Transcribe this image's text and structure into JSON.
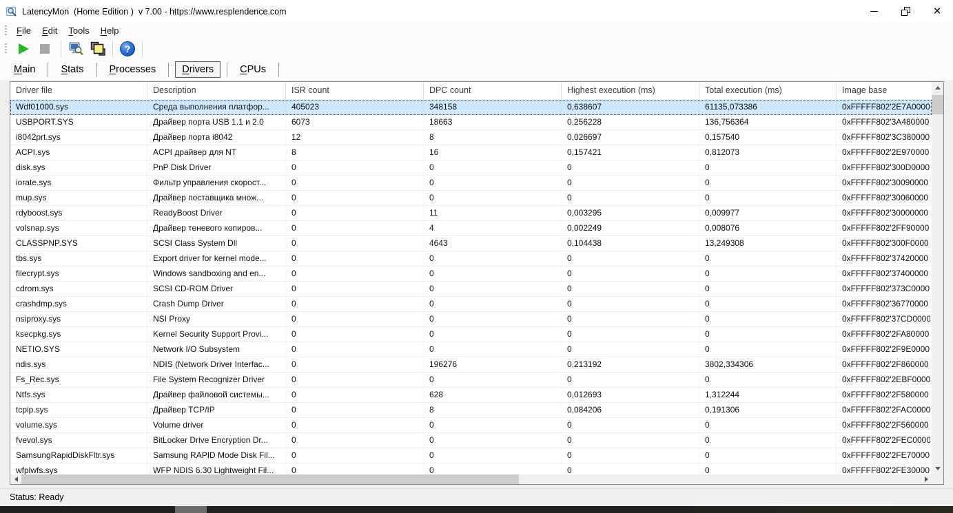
{
  "titlebar": {
    "title": "LatencyMon  (Home Edition )  v 7.00 - https://www.resplendence.com"
  },
  "menu": {
    "items": [
      {
        "label": "File"
      },
      {
        "label": "Edit"
      },
      {
        "label": "Tools"
      },
      {
        "label": "Help"
      }
    ]
  },
  "toolbar": {
    "icons": [
      "play-icon",
      "stop-icon",
      "monitor-analyze-icon",
      "report-windows-icon",
      "help-icon"
    ]
  },
  "tabs": {
    "items": [
      {
        "label": "Main",
        "selected": false
      },
      {
        "label": "Stats",
        "selected": false
      },
      {
        "label": "Processes",
        "selected": false
      },
      {
        "label": "Drivers",
        "selected": true
      },
      {
        "label": "CPUs",
        "selected": false
      }
    ]
  },
  "table": {
    "columns": [
      {
        "key": "driver-file",
        "label": "Driver file"
      },
      {
        "key": "description",
        "label": "Description"
      },
      {
        "key": "isr-count",
        "label": "ISR count"
      },
      {
        "key": "dpc-count",
        "label": "DPC count"
      },
      {
        "key": "highest-execution",
        "label": "Highest execution (ms)"
      },
      {
        "key": "total-execution",
        "label": "Total execution (ms)"
      },
      {
        "key": "image-base",
        "label": "Image base"
      }
    ],
    "rows": [
      {
        "selected": true,
        "cells": [
          "Wdf01000.sys",
          "Среда выполнения платфор...",
          "405023",
          "348158",
          "0,638607",
          "61135,073386",
          "0xFFFFF802'2E7A0000"
        ]
      },
      {
        "selected": false,
        "cells": [
          "USBPORT.SYS",
          "Драйвер порта USB 1.1 и 2.0",
          "6073",
          "18663",
          "0,256228",
          "136,756364",
          "0xFFFFF802'3A480000"
        ]
      },
      {
        "selected": false,
        "cells": [
          "i8042prt.sys",
          "Драйвер порта i8042",
          "12",
          "8",
          "0,026697",
          "0,157540",
          "0xFFFFF802'3C380000"
        ]
      },
      {
        "selected": false,
        "cells": [
          "ACPI.sys",
          "ACPI драйвер для NT",
          "8",
          "16",
          "0,157421",
          "0,812073",
          "0xFFFFF802'2E970000"
        ]
      },
      {
        "selected": false,
        "cells": [
          "disk.sys",
          "PnP Disk Driver",
          "0",
          "0",
          "0",
          "0",
          "0xFFFFF802'300D0000"
        ]
      },
      {
        "selected": false,
        "cells": [
          "iorate.sys",
          "Фильтр управления скорост...",
          "0",
          "0",
          "0",
          "0",
          "0xFFFFF802'30090000"
        ]
      },
      {
        "selected": false,
        "cells": [
          "mup.sys",
          "Драйвер поставщика множ...",
          "0",
          "0",
          "0",
          "0",
          "0xFFFFF802'30060000"
        ]
      },
      {
        "selected": false,
        "cells": [
          "rdyboost.sys",
          "ReadyBoost Driver",
          "0",
          "11",
          "0,003295",
          "0,009977",
          "0xFFFFF802'30000000"
        ]
      },
      {
        "selected": false,
        "cells": [
          "volsnap.sys",
          "Драйвер теневого копиров...",
          "0",
          "4",
          "0,002249",
          "0,008076",
          "0xFFFFF802'2FF90000"
        ]
      },
      {
        "selected": false,
        "cells": [
          "CLASSPNP.SYS",
          "SCSI Class System Dll",
          "0",
          "4643",
          "0,104438",
          "13,249308",
          "0xFFFFF802'300F0000"
        ]
      },
      {
        "selected": false,
        "cells": [
          "tbs.sys",
          "Export driver for kernel mode...",
          "0",
          "0",
          "0",
          "0",
          "0xFFFFF802'37420000"
        ]
      },
      {
        "selected": false,
        "cells": [
          "filecrypt.sys",
          "Windows sandboxing and en...",
          "0",
          "0",
          "0",
          "0",
          "0xFFFFF802'37400000"
        ]
      },
      {
        "selected": false,
        "cells": [
          "cdrom.sys",
          "SCSI CD-ROM Driver",
          "0",
          "0",
          "0",
          "0",
          "0xFFFFF802'373C0000"
        ]
      },
      {
        "selected": false,
        "cells": [
          "crashdmp.sys",
          "Crash Dump Driver",
          "0",
          "0",
          "0",
          "0",
          "0xFFFFF802'36770000"
        ]
      },
      {
        "selected": false,
        "cells": [
          "nsiproxy.sys",
          "NSI Proxy",
          "0",
          "0",
          "0",
          "0",
          "0xFFFFF802'37CD0000"
        ]
      },
      {
        "selected": false,
        "cells": [
          "ksecpkg.sys",
          "Kernel Security Support Provi...",
          "0",
          "0",
          "0",
          "0",
          "0xFFFFF802'2FA80000"
        ]
      },
      {
        "selected": false,
        "cells": [
          "NETIO.SYS",
          "Network I/O Subsystem",
          "0",
          "0",
          "0",
          "0",
          "0xFFFFF802'2F9E0000"
        ]
      },
      {
        "selected": false,
        "cells": [
          "ndis.sys",
          "NDIS (Network Driver Interfac...",
          "0",
          "196276",
          "0,213192",
          "3802,334306",
          "0xFFFFF802'2F860000"
        ]
      },
      {
        "selected": false,
        "cells": [
          "Fs_Rec.sys",
          "File System Recognizer Driver",
          "0",
          "0",
          "0",
          "0",
          "0xFFFFF802'2EBF0000"
        ]
      },
      {
        "selected": false,
        "cells": [
          "Ntfs.sys",
          "Драйвер файловой системы...",
          "0",
          "628",
          "0,012693",
          "1,312244",
          "0xFFFFF802'2F580000"
        ]
      },
      {
        "selected": false,
        "cells": [
          "tcpip.sys",
          "Драйвер TCP/IP",
          "0",
          "8",
          "0,084206",
          "0,191306",
          "0xFFFFF802'2FAC0000"
        ]
      },
      {
        "selected": false,
        "cells": [
          "volume.sys",
          "Volume driver",
          "0",
          "0",
          "0",
          "0",
          "0xFFFFF802'2F560000"
        ]
      },
      {
        "selected": false,
        "cells": [
          "fvevol.sys",
          "BitLocker Drive Encryption Dr...",
          "0",
          "0",
          "0",
          "0",
          "0xFFFFF802'2FEC0000"
        ]
      },
      {
        "selected": false,
        "cells": [
          "SamsungRapidDiskFltr.sys",
          "Samsung RAPID Mode Disk Fil...",
          "0",
          "0",
          "0",
          "0",
          "0xFFFFF802'2FE70000"
        ]
      },
      {
        "selected": false,
        "cells": [
          "wfplwfs.sys",
          "WFP NDIS 6.30 Lightweight Fil...",
          "0",
          "0",
          "0",
          "0",
          "0xFFFFF802'2FE30000"
        ]
      }
    ]
  },
  "statusbar": {
    "text": "Status: Ready"
  },
  "colors": {
    "selection": "#cce8ff",
    "play_green": "#2eb32e",
    "help_blue": "#2f6fd6",
    "frame_border": "#828790",
    "taskbar_dark": "#232220"
  }
}
